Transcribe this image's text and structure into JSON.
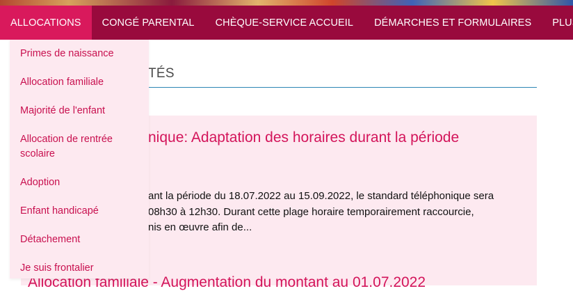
{
  "nav": {
    "items": [
      {
        "label": "ALLOCATIONS",
        "active": true
      },
      {
        "label": "CONGÉ PARENTAL"
      },
      {
        "label": "CHÈQUE-SERVICE ACCUEIL"
      },
      {
        "label": "DÉMARCHES ET FORMULAIRES"
      },
      {
        "label": "PLUS"
      }
    ]
  },
  "dropdown": {
    "items": [
      {
        "label": "Primes de naissance"
      },
      {
        "label": "Allocation familiale"
      },
      {
        "label": "Majorité de l'enfant"
      },
      {
        "label": "Allocation de rentrée scolaire"
      },
      {
        "label": "Adoption"
      },
      {
        "label": "Enfant handicapé"
      },
      {
        "label": "Détachement"
      },
      {
        "label": "Je suis frontalier"
      }
    ]
  },
  "section": {
    "title_visible": "TÉS"
  },
  "news": [
    {
      "title_visible": "nique: Adaptation des horaires durant la période",
      "excerpt_lines": [
        "ant la période du 18.07.2022 au 15.09.2022, le standard téléphonique sera",
        "08h30 à 12h30. Durant cette plage horaire temporairement raccourcie,",
        "nis en œuvre afin de..."
      ]
    },
    {
      "title_visible": "Allocation familiale - Augmentation du montant au 01.07.2022"
    }
  ],
  "colors": {
    "nav_bg": "#990a3d",
    "nav_active": "#d9195c",
    "dropdown_bg": "#fde9f0",
    "accent_text": "#d3145a",
    "divider": "#2c86b4"
  }
}
